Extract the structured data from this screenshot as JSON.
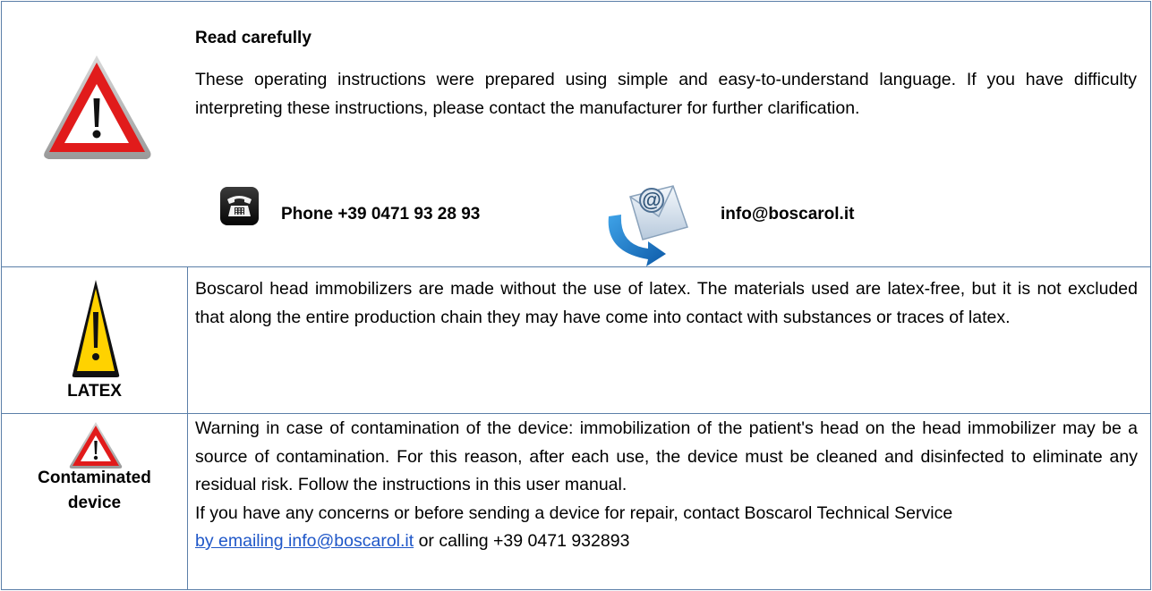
{
  "read_carefully": {
    "title": "Read carefully",
    "text": "These operating instructions were prepared using simple and easy-to-understand language. If you have difficulty interpreting these instructions, please contact the manufacturer for further clarification.",
    "phone_label": "Phone +39 0471 93 28 93",
    "email_label": "info@boscarol.it"
  },
  "latex": {
    "label": "LATEX",
    "text": "Boscarol head immobilizers are made without the use of latex. The materials used are latex-free, but it is not excluded that along the entire production chain they may have come into contact with substances or traces of latex."
  },
  "contaminated": {
    "label_line1": "Contaminated",
    "label_line2": "device",
    "warning_text": "Warning in case of contamination of the device: immobilization of the patient's head on the head immobilizer may be a source of contamination. For this reason, after each use, the device must be cleaned and disinfected to eliminate any residual risk. Follow the instructions in this user manual.",
    "concerns_text": "If you have any concerns or before sending a device for repair, contact Boscarol Technical Service",
    "link_text": "by emailing info@boscarol.it",
    "after_link_text": " or calling +39 0471 932893"
  },
  "colors": {
    "border": "#5b7fa8",
    "warning_red": "#e11b1b",
    "latex_yellow": "#ffd200",
    "link_blue": "#1f57c8"
  }
}
